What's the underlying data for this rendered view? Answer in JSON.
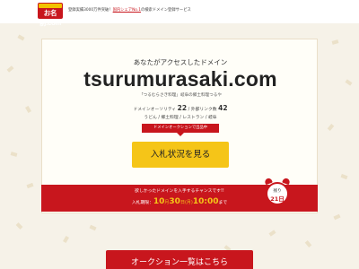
{
  "header": {
    "logo_text": "お名前.com",
    "tagline_prefix": "登録実績3000万件突破！",
    "tagline_link": "国内シェアNo.1",
    "tagline_suffix": "の検索ドメイン登録サービス"
  },
  "card": {
    "subtitle": "あなたがアクセスしたドメイン",
    "domain": "tsurumurasaki.com",
    "description": "「つるむらさき料理」岐阜の郷土料理つるや",
    "authority_label": "ドメインオーソリティ",
    "authority_value": "22",
    "backlinks_label": "/ 外部リンク数",
    "backlinks_value": "42",
    "categories": "うどん / 郷土料理 / レストラン / 岐阜",
    "badge": "ドメインオークションで出品中",
    "bid_button": "入札状況を見る"
  },
  "banner": {
    "message": "欲しかったドメインを入手するチャンスです!!",
    "deadline_label": "入札期限：",
    "month": "10",
    "month_unit": "月",
    "day": "30",
    "day_unit": "日(月)",
    "time": "10:00",
    "time_suffix": "まで"
  },
  "clock": {
    "remaining_label": "残り",
    "days": "21日"
  },
  "footer": {
    "auction_list_button": "オークション一覧はこちら"
  },
  "colors": {
    "brand_red": "#c8161d",
    "accent_yellow": "#f5c518",
    "background": "#f6f2e8"
  }
}
